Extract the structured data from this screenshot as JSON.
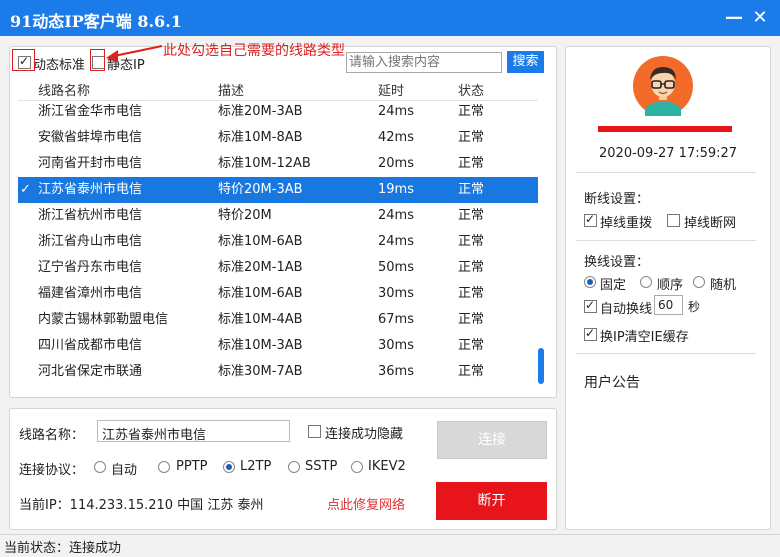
{
  "window": {
    "title": "91动态IP客户端 8.6.1",
    "minimize": "—",
    "close": "✕"
  },
  "filter": {
    "dynamic_label": "动态标准",
    "static_label": "静态IP",
    "annotation": "此处勾选自己需要的线路类型",
    "search_placeholder": "请输入搜索内容",
    "search_button": "搜索"
  },
  "table": {
    "columns": [
      "线路名称",
      "描述",
      "延时",
      "状态"
    ],
    "rows": [
      {
        "name": "浙江省金华市电信",
        "desc": "标准20M-3AB",
        "delay": "24ms",
        "status": "正常",
        "selected": false
      },
      {
        "name": "安徽省蚌埠市电信",
        "desc": "标准10M-8AB",
        "delay": "42ms",
        "status": "正常",
        "selected": false
      },
      {
        "name": "河南省开封市电信",
        "desc": "标准10M-12AB",
        "delay": "20ms",
        "status": "正常",
        "selected": false
      },
      {
        "name": "江苏省泰州市电信",
        "desc": "特价20M-3AB",
        "delay": "19ms",
        "status": "正常",
        "selected": true,
        "check": "✓"
      },
      {
        "name": "浙江省杭州市电信",
        "desc": "特价20M",
        "delay": "24ms",
        "status": "正常",
        "selected": false
      },
      {
        "name": "浙江省舟山市电信",
        "desc": "标准10M-6AB",
        "delay": "24ms",
        "status": "正常",
        "selected": false
      },
      {
        "name": "辽宁省丹东市电信",
        "desc": "标准20M-1AB",
        "delay": "50ms",
        "status": "正常",
        "selected": false
      },
      {
        "name": "福建省漳州市电信",
        "desc": "标准10M-6AB",
        "delay": "30ms",
        "status": "正常",
        "selected": false
      },
      {
        "name": "内蒙古锡林郭勒盟电信",
        "desc": "标准10M-4AB",
        "delay": "67ms",
        "status": "正常",
        "selected": false
      },
      {
        "name": "四川省成都市电信",
        "desc": "标准10M-3AB",
        "delay": "30ms",
        "status": "正常",
        "selected": false
      },
      {
        "name": "河北省保定市联通",
        "desc": "标准30M-7AB",
        "delay": "36ms",
        "status": "正常",
        "selected": false
      }
    ]
  },
  "connect": {
    "line_name_label": "线路名称：",
    "line_name_value": "江苏省泰州市电信",
    "hide_label": "连接成功隐藏",
    "connect_button": "连接",
    "protocol_label": "连接协议：",
    "protocols": [
      "自动",
      "PPTP",
      "L2TP",
      "SSTP",
      "IKEV2"
    ],
    "protocol_selected": "L2TP",
    "current_ip": "当前IP：114.233.15.210 中国 江苏 泰州",
    "repair_link": "点此修复网络",
    "disconnect_button": "断开"
  },
  "user": {
    "datetime": "2020-09-27 17:59:27"
  },
  "settings": {
    "drop_title": "断线设置：",
    "drop_redial": "掉线重拨",
    "drop_disconnect": "掉线断网",
    "switch_title": "换线设置：",
    "switch_fixed": "固定",
    "switch_order": "顺序",
    "switch_random": "随机",
    "auto_switch": "自动换线",
    "auto_switch_value": "60",
    "seconds": "秒",
    "clear_cache": "换IP清空IE缓存",
    "notice_title": "用户公告"
  },
  "status": {
    "text": "当前状态：连接成功"
  },
  "colors": {
    "title_bar": "#1b7be8",
    "selected_row": "#1878e0",
    "disconnect": "#e8141c",
    "annotation": "#e02020"
  }
}
